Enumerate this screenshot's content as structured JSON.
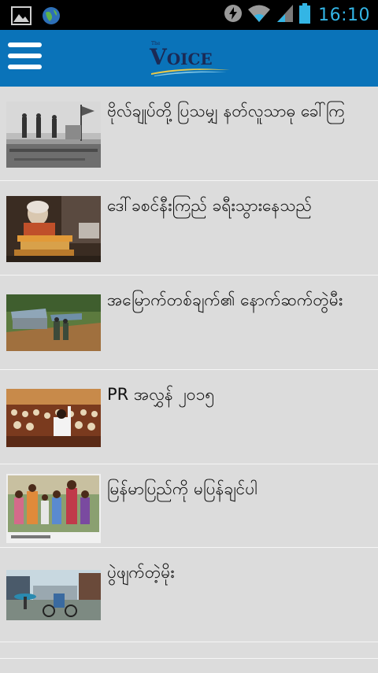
{
  "status_bar": {
    "time": "16:10",
    "icons": [
      "gallery-icon",
      "globe-icon",
      "battery-saver-icon",
      "wifi-icon",
      "signal-icon",
      "battery-icon"
    ]
  },
  "app_bar": {
    "logo_small": "The",
    "logo_text": "Voice",
    "colors": {
      "bar": "#0a73b9",
      "logo": "#1b2a55"
    }
  },
  "articles": [
    {
      "title": "ဗိုလ်ချုပ်တို့ ပြသမျှ နတ်လူသာဓု ခေါ်ကြ"
    },
    {
      "title": "ဒေါ်ခစင်နီးကြည် ခရီးသွားနေသည်"
    },
    {
      "title": "အမြောက်တစ်ချက်၏ နောက်ဆက်တွဲမီး"
    },
    {
      "title": "PR အလွှန် ၂၀၁၅"
    },
    {
      "title": "မြန်မာပြည်ကို မပြန်ချင်ပါ"
    },
    {
      "title": "ပွဲဖျက်တဲ့မိုး"
    }
  ]
}
